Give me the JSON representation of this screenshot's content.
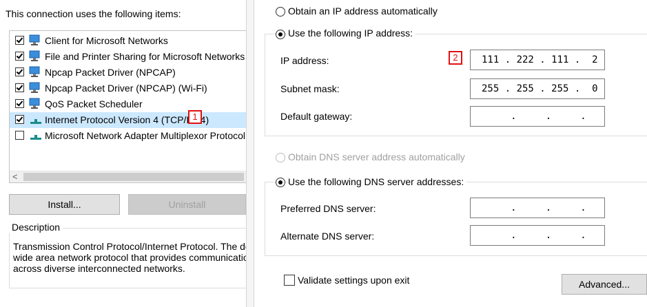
{
  "left_dialog": {
    "connection_label": "This connection uses the following items:",
    "items": [
      {
        "label": "Client for Microsoft Networks",
        "checked": true
      },
      {
        "label": "File and Printer Sharing for Microsoft Networks",
        "checked": true
      },
      {
        "label": "Npcap Packet Driver (NPCAP)",
        "checked": true
      },
      {
        "label": "Npcap Packet Driver (NPCAP) (Wi-Fi)",
        "checked": true
      },
      {
        "label": "QoS Packet Scheduler",
        "checked": true
      },
      {
        "label": "Internet Protocol Version 4 (TCP/IPv4)",
        "checked": true
      },
      {
        "label": "Microsoft Network Adapter Multiplexor Protocol",
        "checked": false
      }
    ],
    "scroll_left_arrow": "<",
    "install_label": "Install...",
    "uninstall_label": "Uninstall",
    "description_title": "Description",
    "description_text": "Transmission Control Protocol/Internet Protocol. The default\nwide area network protocol that provides communication\nacross diverse interconnected networks."
  },
  "right_dialog": {
    "obtain_ip_auto": "Obtain an IP address automatically",
    "use_following_ip": "Use the following IP address:",
    "ip_address_label": "IP address:",
    "ip_address_value": "111 . 222 . 111 .  2",
    "subnet_mask_label": "Subnet mask:",
    "subnet_mask_value": "255 . 255 . 255 .  0",
    "default_gateway_label": "Default gateway:",
    "default_gateway_value": "     .     .     .",
    "obtain_dns_auto": "Obtain DNS server address automatically",
    "use_following_dns": "Use the following DNS server addresses:",
    "preferred_dns_label": "Preferred DNS server:",
    "preferred_dns_value": "     .     .     .",
    "alternate_dns_label": "Alternate DNS server:",
    "alternate_dns_value": "     .     .     .",
    "validate_label": "Validate settings upon exit",
    "advanced_label": "Advanced..."
  },
  "annotations": {
    "badge_1": "1",
    "badge_2": "2"
  },
  "colors": {
    "selection": "#cce8ff",
    "badge_red": "#e01010",
    "icon_teal": "#1a8c8c",
    "icon_blue": "#2a7ad6"
  }
}
